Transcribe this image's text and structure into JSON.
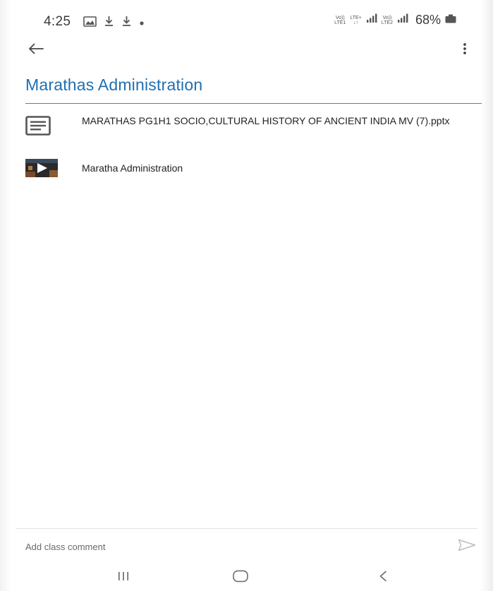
{
  "status_bar": {
    "time": "4:25",
    "left_icons": [
      "gallery-icon",
      "download-icon",
      "download-icon",
      "dot-icon"
    ],
    "sim1_label_top": "Vo))",
    "sim1_label_bottom": "LTE1",
    "net_label_top": "LTE+",
    "net_label_bottom": "↓↑",
    "sim2_label_top": "Vo))",
    "sim2_label_bottom": "LTE2",
    "battery": "68%"
  },
  "app_bar": {
    "back_icon": "arrow-back-icon",
    "more_icon": "more-vert-icon"
  },
  "page": {
    "title": "Marathas Administration",
    "accent": "#1f6fb2"
  },
  "materials": [
    {
      "icon": "document-icon",
      "label": "MARATHAS PG1H1 SOCIO,CULTURAL HISTORY OF ANCIENT INDIA MV (7).pptx"
    },
    {
      "icon": "video-thumbnail-icon",
      "label": "Maratha Administration"
    }
  ],
  "comment": {
    "placeholder": "Add class comment",
    "send_icon": "send-icon"
  },
  "nav_bar": {
    "recents_icon": "recents-icon",
    "home_icon": "home-icon",
    "back_icon": "nav-back-icon"
  }
}
